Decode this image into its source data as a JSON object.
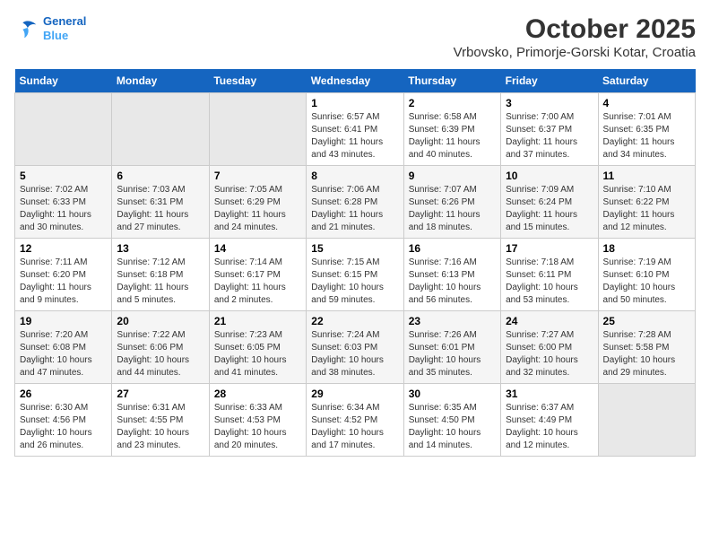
{
  "logo": {
    "line1": "General",
    "line2": "Blue"
  },
  "title": "October 2025",
  "subtitle": "Vrbovsko, Primorje-Gorski Kotar, Croatia",
  "days_of_week": [
    "Sunday",
    "Monday",
    "Tuesday",
    "Wednesday",
    "Thursday",
    "Friday",
    "Saturday"
  ],
  "weeks": [
    [
      {
        "day": "",
        "info": ""
      },
      {
        "day": "",
        "info": ""
      },
      {
        "day": "",
        "info": ""
      },
      {
        "day": "1",
        "info": "Sunrise: 6:57 AM\nSunset: 6:41 PM\nDaylight: 11 hours and 43 minutes."
      },
      {
        "day": "2",
        "info": "Sunrise: 6:58 AM\nSunset: 6:39 PM\nDaylight: 11 hours and 40 minutes."
      },
      {
        "day": "3",
        "info": "Sunrise: 7:00 AM\nSunset: 6:37 PM\nDaylight: 11 hours and 37 minutes."
      },
      {
        "day": "4",
        "info": "Sunrise: 7:01 AM\nSunset: 6:35 PM\nDaylight: 11 hours and 34 minutes."
      }
    ],
    [
      {
        "day": "5",
        "info": "Sunrise: 7:02 AM\nSunset: 6:33 PM\nDaylight: 11 hours and 30 minutes."
      },
      {
        "day": "6",
        "info": "Sunrise: 7:03 AM\nSunset: 6:31 PM\nDaylight: 11 hours and 27 minutes."
      },
      {
        "day": "7",
        "info": "Sunrise: 7:05 AM\nSunset: 6:29 PM\nDaylight: 11 hours and 24 minutes."
      },
      {
        "day": "8",
        "info": "Sunrise: 7:06 AM\nSunset: 6:28 PM\nDaylight: 11 hours and 21 minutes."
      },
      {
        "day": "9",
        "info": "Sunrise: 7:07 AM\nSunset: 6:26 PM\nDaylight: 11 hours and 18 minutes."
      },
      {
        "day": "10",
        "info": "Sunrise: 7:09 AM\nSunset: 6:24 PM\nDaylight: 11 hours and 15 minutes."
      },
      {
        "day": "11",
        "info": "Sunrise: 7:10 AM\nSunset: 6:22 PM\nDaylight: 11 hours and 12 minutes."
      }
    ],
    [
      {
        "day": "12",
        "info": "Sunrise: 7:11 AM\nSunset: 6:20 PM\nDaylight: 11 hours and 9 minutes."
      },
      {
        "day": "13",
        "info": "Sunrise: 7:12 AM\nSunset: 6:18 PM\nDaylight: 11 hours and 5 minutes."
      },
      {
        "day": "14",
        "info": "Sunrise: 7:14 AM\nSunset: 6:17 PM\nDaylight: 11 hours and 2 minutes."
      },
      {
        "day": "15",
        "info": "Sunrise: 7:15 AM\nSunset: 6:15 PM\nDaylight: 10 hours and 59 minutes."
      },
      {
        "day": "16",
        "info": "Sunrise: 7:16 AM\nSunset: 6:13 PM\nDaylight: 10 hours and 56 minutes."
      },
      {
        "day": "17",
        "info": "Sunrise: 7:18 AM\nSunset: 6:11 PM\nDaylight: 10 hours and 53 minutes."
      },
      {
        "day": "18",
        "info": "Sunrise: 7:19 AM\nSunset: 6:10 PM\nDaylight: 10 hours and 50 minutes."
      }
    ],
    [
      {
        "day": "19",
        "info": "Sunrise: 7:20 AM\nSunset: 6:08 PM\nDaylight: 10 hours and 47 minutes."
      },
      {
        "day": "20",
        "info": "Sunrise: 7:22 AM\nSunset: 6:06 PM\nDaylight: 10 hours and 44 minutes."
      },
      {
        "day": "21",
        "info": "Sunrise: 7:23 AM\nSunset: 6:05 PM\nDaylight: 10 hours and 41 minutes."
      },
      {
        "day": "22",
        "info": "Sunrise: 7:24 AM\nSunset: 6:03 PM\nDaylight: 10 hours and 38 minutes."
      },
      {
        "day": "23",
        "info": "Sunrise: 7:26 AM\nSunset: 6:01 PM\nDaylight: 10 hours and 35 minutes."
      },
      {
        "day": "24",
        "info": "Sunrise: 7:27 AM\nSunset: 6:00 PM\nDaylight: 10 hours and 32 minutes."
      },
      {
        "day": "25",
        "info": "Sunrise: 7:28 AM\nSunset: 5:58 PM\nDaylight: 10 hours and 29 minutes."
      }
    ],
    [
      {
        "day": "26",
        "info": "Sunrise: 6:30 AM\nSunset: 4:56 PM\nDaylight: 10 hours and 26 minutes."
      },
      {
        "day": "27",
        "info": "Sunrise: 6:31 AM\nSunset: 4:55 PM\nDaylight: 10 hours and 23 minutes."
      },
      {
        "day": "28",
        "info": "Sunrise: 6:33 AM\nSunset: 4:53 PM\nDaylight: 10 hours and 20 minutes."
      },
      {
        "day": "29",
        "info": "Sunrise: 6:34 AM\nSunset: 4:52 PM\nDaylight: 10 hours and 17 minutes."
      },
      {
        "day": "30",
        "info": "Sunrise: 6:35 AM\nSunset: 4:50 PM\nDaylight: 10 hours and 14 minutes."
      },
      {
        "day": "31",
        "info": "Sunrise: 6:37 AM\nSunset: 4:49 PM\nDaylight: 10 hours and 12 minutes."
      },
      {
        "day": "",
        "info": ""
      }
    ]
  ]
}
